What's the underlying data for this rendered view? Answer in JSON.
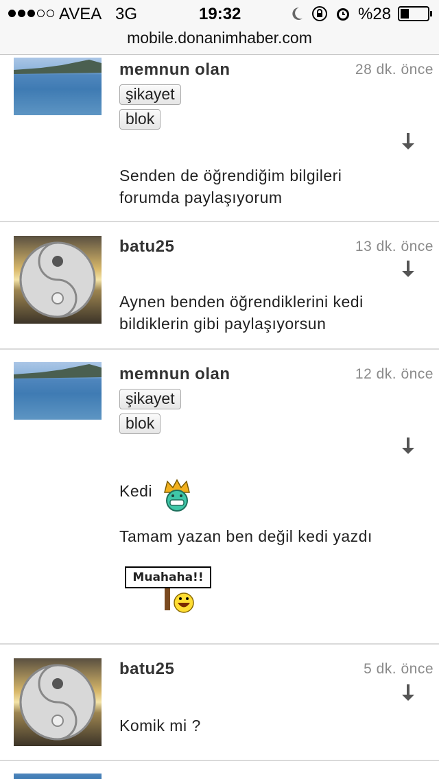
{
  "status_bar": {
    "carrier": "AVEA",
    "network": "3G",
    "time": "19:32",
    "battery": "%28"
  },
  "url_bar": {
    "url": "mobile.donanimhaber.com"
  },
  "posts": [
    {
      "username": "memnun olan",
      "time": "28 dk. önce",
      "report_label": "şikayet",
      "block_label": "blok",
      "message_lines": [
        "Senden de öğrendiğim bilgileri",
        "forumda paylaşıyorum"
      ]
    },
    {
      "username": "batu25",
      "time": "13 dk. önce",
      "message_lines": [
        "Aynen benden öğrendiklerini kedi",
        "bildiklerin gibi paylaşıyorsun"
      ]
    },
    {
      "username": "memnun olan",
      "time": "12 dk. önce",
      "report_label": "şikayet",
      "block_label": "blok",
      "message_lines": [
        "Kedi",
        "Tamam yazan ben değil kedi yazdı"
      ],
      "sign_text": "Muahaha!!"
    },
    {
      "username": "batu25",
      "time": "5 dk. önce",
      "message_lines": [
        "Komik mi ?"
      ]
    }
  ]
}
